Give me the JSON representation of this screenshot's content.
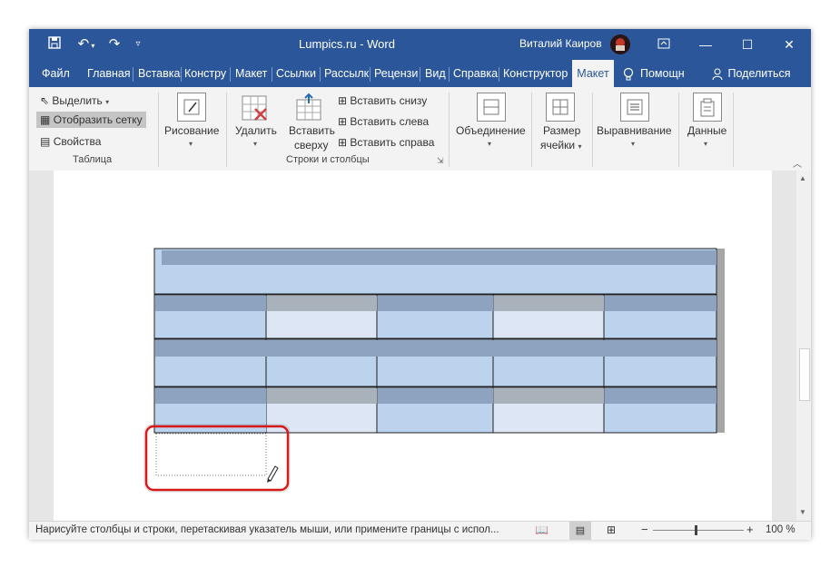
{
  "titlebar": {
    "title": "Lumpics.ru  -  Word",
    "user": "Виталий Каиров",
    "save_icon": "save-icon",
    "undo_icon": "undo-icon",
    "redo_icon": "redo-icon",
    "customize_icon": "customize-icon"
  },
  "tabs": [
    {
      "label": "Файл"
    },
    {
      "label": "Главная"
    },
    {
      "label": "Вставка"
    },
    {
      "label": "Констру"
    },
    {
      "label": "Макет"
    },
    {
      "label": "Ссылки"
    },
    {
      "label": "Рассылк"
    },
    {
      "label": "Рецензи"
    },
    {
      "label": "Вид"
    },
    {
      "label": "Справка"
    },
    {
      "label": "Конструктор"
    },
    {
      "label": "Макет"
    },
    {
      "label": "Помощн"
    },
    {
      "label": "Поделиться"
    }
  ],
  "ribbon": {
    "table_group": {
      "select": "Выделить",
      "show_grid": "Отобразить сетку",
      "properties": "Свойства",
      "group_label": "Таблица"
    },
    "draw": "Рисование",
    "delete": "Удалить",
    "insert_above_1": "Вставить",
    "insert_above_2": "сверху",
    "insert_below": "Вставить снизу",
    "insert_left": "Вставить слева",
    "insert_right": "Вставить справа",
    "rows_cols_label": "Строки и столбцы",
    "merge": "Объединение",
    "cell_size_1": "Размер",
    "cell_size_2": "ячейки",
    "alignment": "Выравнивание",
    "data": "Данные"
  },
  "status": {
    "hint": "Нарисуйте столбцы и строки, перетаскивая указатель мыши, или примените границы с испол...",
    "zoom": "100 %",
    "zoom_minus": "−",
    "zoom_plus": "+"
  },
  "colors": {
    "brand": "#2b579a",
    "cell_blue": "#bcd3ee",
    "cell_light": "#dce6f4",
    "header_dark": "#8ea3bf",
    "header_gray": "#a9b1ba",
    "highlight_red": "#d61a1a"
  }
}
